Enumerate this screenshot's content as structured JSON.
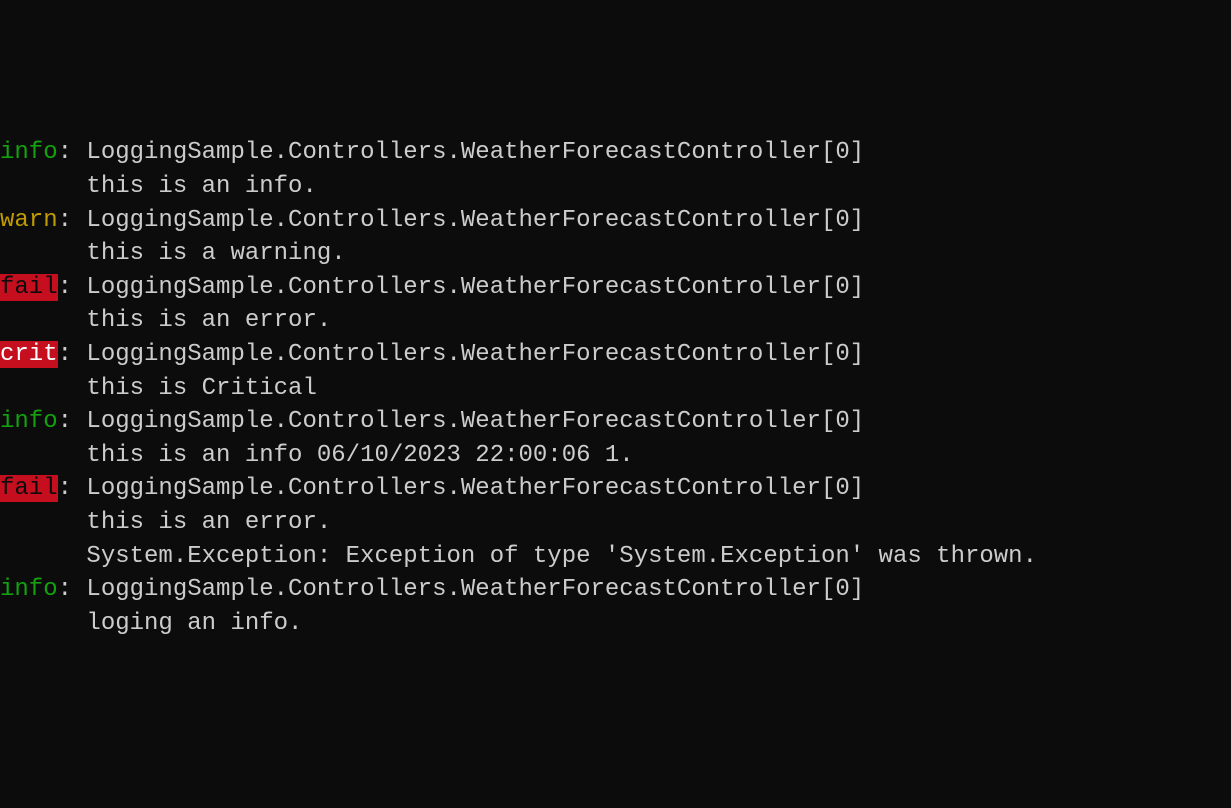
{
  "logs": [
    {
      "level": "info",
      "levelClass": "level-info",
      "source": "LoggingSample.Controllers.WeatherForecastController[0]",
      "messages": [
        "this is an info."
      ]
    },
    {
      "level": "warn",
      "levelClass": "level-warn",
      "source": "LoggingSample.Controllers.WeatherForecastController[0]",
      "messages": [
        "this is a warning."
      ]
    },
    {
      "level": "fail",
      "levelClass": "level-fail",
      "source": "LoggingSample.Controllers.WeatherForecastController[0]",
      "messages": [
        "this is an error."
      ]
    },
    {
      "level": "crit",
      "levelClass": "level-crit",
      "source": "LoggingSample.Controllers.WeatherForecastController[0]",
      "messages": [
        "this is Critical"
      ]
    },
    {
      "level": "info",
      "levelClass": "level-info",
      "source": "LoggingSample.Controllers.WeatherForecastController[0]",
      "messages": [
        "this is an info 06/10/2023 22:00:06 1."
      ]
    },
    {
      "level": "fail",
      "levelClass": "level-fail",
      "source": "LoggingSample.Controllers.WeatherForecastController[0]",
      "messages": [
        "this is an error.",
        "System.Exception: Exception of type 'System.Exception' was thrown."
      ]
    },
    {
      "level": "info",
      "levelClass": "level-info",
      "source": "LoggingSample.Controllers.WeatherForecastController[0]",
      "messages": [
        "loging an info."
      ]
    }
  ]
}
